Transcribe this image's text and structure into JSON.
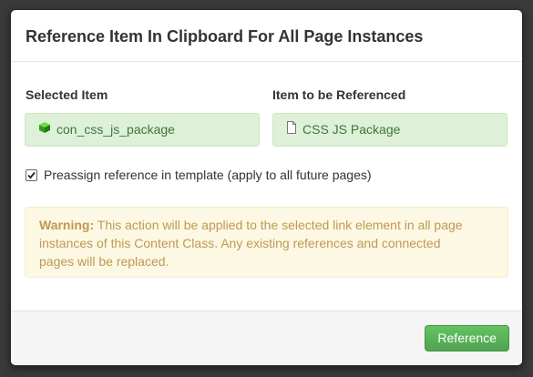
{
  "dialog": {
    "title": "Reference Item In Clipboard For All Page Instances"
  },
  "selected": {
    "label": "Selected Item",
    "value": "con_css_js_package",
    "icon": "green-cube-icon"
  },
  "target": {
    "label": "Item to be Referenced",
    "value": "CSS JS Package",
    "icon": "page-icon"
  },
  "preassign": {
    "label": "Preassign reference in template (apply to all future pages)",
    "checked": true
  },
  "warning": {
    "prefix": "Warning:",
    "text": "This action will be applied to the selected link element in all page instances of this Content Class. Any existing references and connected pages will be replaced."
  },
  "footer": {
    "button_label": "Reference"
  },
  "colors": {
    "success_bg": "#dff0d8",
    "success_text": "#3c763d",
    "warning_bg": "#fcf8e3",
    "warning_text": "#c09853",
    "button_green": "#5bb75b"
  }
}
